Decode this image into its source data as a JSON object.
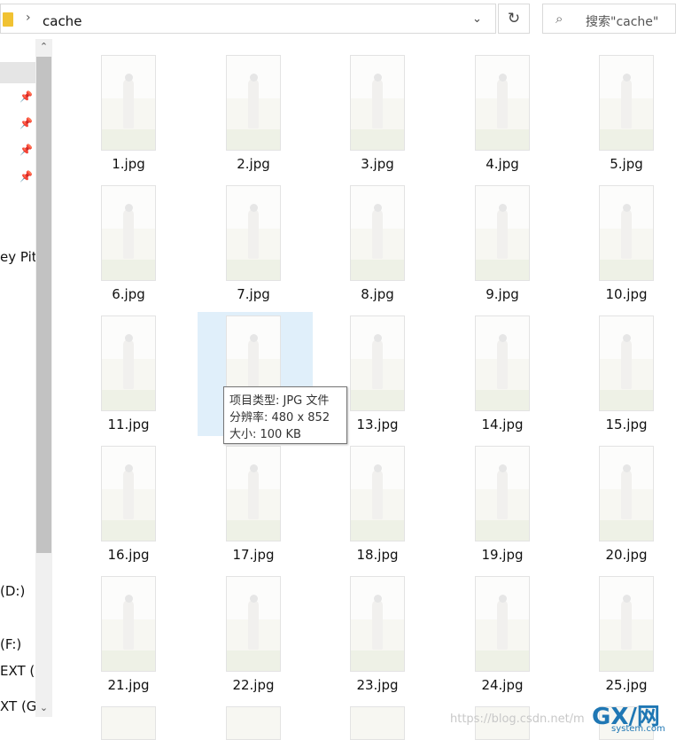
{
  "address_bar": {
    "path": "cache",
    "breadcrumb_separator": "›",
    "dropdown_glyph": "⌄",
    "refresh_glyph": "↻"
  },
  "search": {
    "text": "搜索\"cache\"",
    "icon": "⌕"
  },
  "sidebar": {
    "pins": [
      "📌",
      "📌",
      "📌",
      "📌"
    ],
    "labels": [
      {
        "text": "ey Pit"
      },
      {
        "text": "(D:)"
      },
      {
        "text": "(F:)"
      },
      {
        "text": "EXT (("
      },
      {
        "text": "XT (G:"
      }
    ],
    "scroll_up": "⌃",
    "scroll_down": "⌄"
  },
  "files": [
    "1.jpg",
    "2.jpg",
    "3.jpg",
    "4.jpg",
    "5.jpg",
    "6.jpg",
    "7.jpg",
    "8.jpg",
    "9.jpg",
    "10.jpg",
    "11.jpg",
    "12.jpg",
    "13.jpg",
    "14.jpg",
    "15.jpg",
    "16.jpg",
    "17.jpg",
    "18.jpg",
    "19.jpg",
    "20.jpg",
    "21.jpg",
    "22.jpg",
    "23.jpg",
    "24.jpg",
    "25.jpg"
  ],
  "selected_file": "12.jpg",
  "tooltip": {
    "line1": "项目类型: JPG 文件",
    "line2": "分辨率: 480 x 852",
    "line3": "大小: 100 KB"
  },
  "watermark": {
    "url": "https://blog.csdn.net/m",
    "logo": "GX/网",
    "sub": "system.com"
  }
}
